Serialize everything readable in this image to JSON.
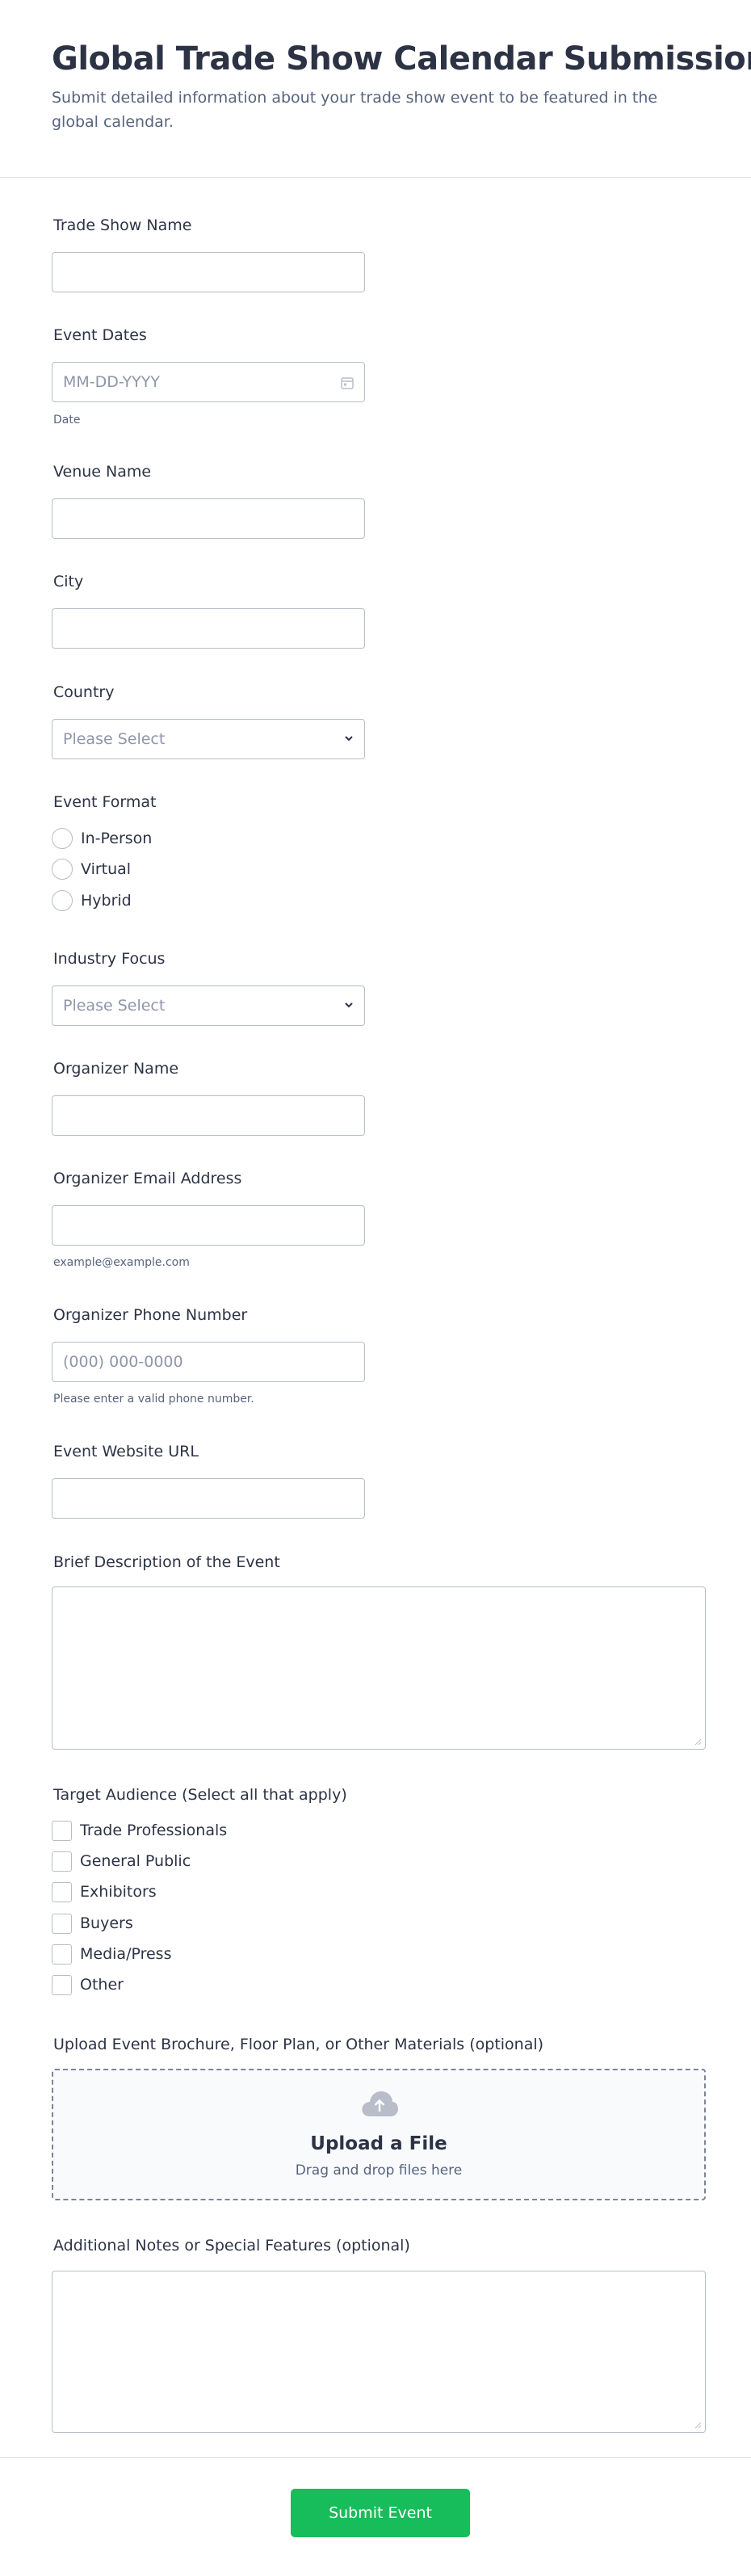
{
  "header": {
    "title": "Global Trade Show Calendar Submission",
    "subtitle": "Submit detailed information about your trade show event to be featured in the global calendar."
  },
  "fields": {
    "trade_show_name": {
      "label": "Trade Show Name"
    },
    "event_dates": {
      "label": "Event Dates",
      "placeholder": "MM-DD-YYYY",
      "sublabel": "Date"
    },
    "venue_name": {
      "label": "Venue Name"
    },
    "city": {
      "label": "City"
    },
    "country": {
      "label": "Country",
      "selected": "Please Select"
    },
    "event_format": {
      "label": "Event Format",
      "options": [
        "In-Person",
        "Virtual",
        "Hybrid"
      ]
    },
    "industry_focus": {
      "label": "Industry Focus",
      "selected": "Please Select"
    },
    "organizer_name": {
      "label": "Organizer Name"
    },
    "organizer_email": {
      "label": "Organizer Email Address",
      "sublabel": "example@example.com"
    },
    "organizer_phone": {
      "label": "Organizer Phone Number",
      "placeholder": "(000) 000-0000",
      "sublabel": "Please enter a valid phone number."
    },
    "event_website": {
      "label": "Event Website URL"
    },
    "description": {
      "label": "Brief Description of the Event"
    },
    "target_audience": {
      "label": "Target Audience (Select all that apply)",
      "options": [
        "Trade Professionals",
        "General Public",
        "Exhibitors",
        "Buyers",
        "Media/Press",
        "Other"
      ]
    },
    "upload": {
      "label": "Upload Event Brochure, Floor Plan, or Other Materials (optional)",
      "title": "Upload a File",
      "subtitle": "Drag and drop files here"
    },
    "notes": {
      "label": "Additional Notes or Special Features (optional)"
    }
  },
  "footer": {
    "submit_label": "Submit Event"
  },
  "icons": {
    "calendar": "calendar-icon",
    "chevron": "chevron-down-icon",
    "upload": "cloud-upload-icon",
    "resize": "resize-handle-icon"
  },
  "colors": {
    "accent": "#18bd5b",
    "text": "#2c3345",
    "muted": "#57647e",
    "border": "#b8bdc9"
  }
}
